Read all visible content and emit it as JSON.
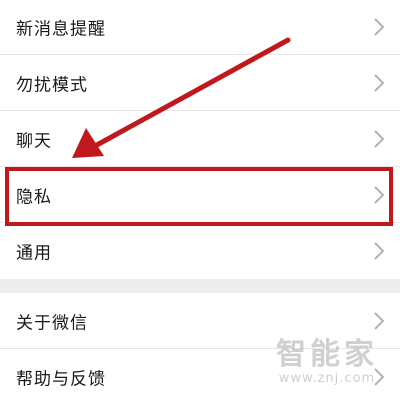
{
  "settings": {
    "group1": [
      {
        "label": "新消息提醒"
      },
      {
        "label": "勿扰模式"
      },
      {
        "label": "聊天"
      },
      {
        "label": "隐私"
      },
      {
        "label": "通用"
      }
    ],
    "group2": [
      {
        "label": "关于微信"
      },
      {
        "label": "帮助与反馈"
      }
    ]
  },
  "annotation": {
    "color": "#c0181d",
    "highlighted_item": "隐私"
  },
  "watermark": {
    "brand": "智能家",
    "url": "www.znj.com"
  },
  "icons": {
    "chevron": "chevron-right-icon",
    "arrow": "annotation-arrow-icon"
  }
}
